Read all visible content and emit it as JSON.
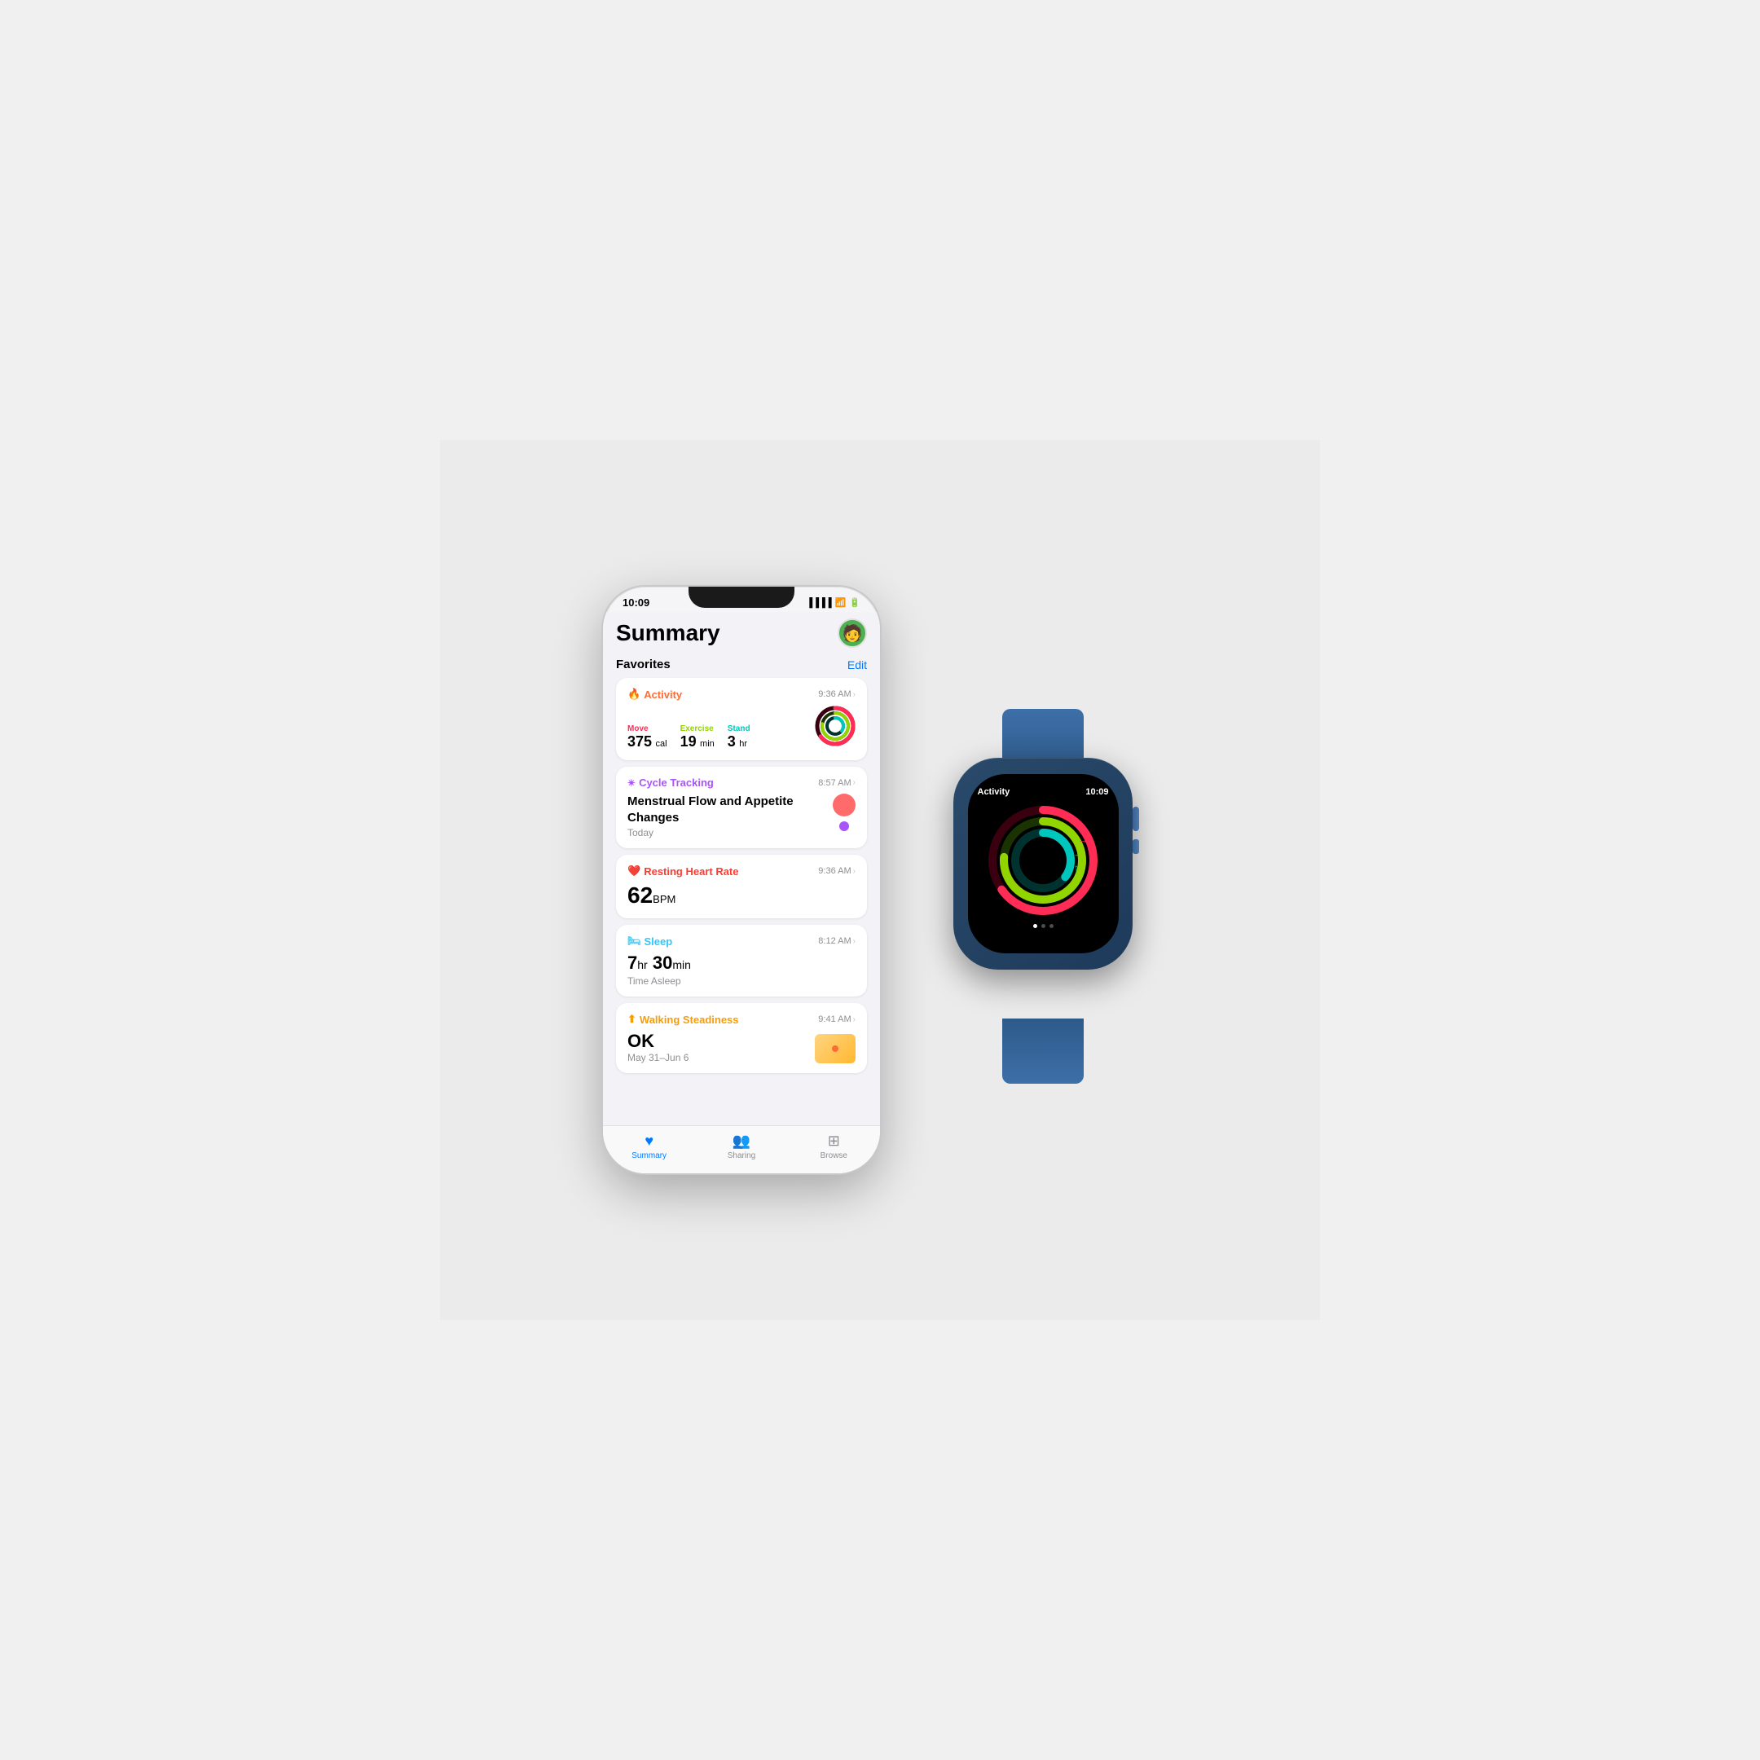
{
  "scene": {
    "background": "#ebebeb"
  },
  "iphone": {
    "status": {
      "time": "10:09",
      "signal": "●●●●",
      "wifi": "WiFi",
      "battery": "Battery"
    },
    "app": {
      "title": "Summary",
      "avatar_emoji": "🧑"
    },
    "favorites": {
      "label": "Favorites",
      "edit_label": "Edit"
    },
    "cards": {
      "activity": {
        "title": "Activity",
        "icon": "🔥",
        "time": "9:36 AM",
        "move_label": "Move",
        "move_value": "375",
        "move_unit": "cal",
        "exercise_label": "Exercise",
        "exercise_value": "19",
        "exercise_unit": "min",
        "stand_label": "Stand",
        "stand_value": "3",
        "stand_unit": "hr"
      },
      "cycle": {
        "title": "Cycle Tracking",
        "icon": "✴️",
        "time": "8:57 AM",
        "main_text": "Menstrual Flow and Appetite Changes",
        "sub_text": "Today"
      },
      "heart": {
        "title": "Resting Heart Rate",
        "icon": "❤️",
        "time": "9:36 AM",
        "value": "62",
        "unit": "BPM"
      },
      "sleep": {
        "title": "Sleep",
        "icon": "🛏",
        "time": "8:12 AM",
        "hours": "7",
        "hours_unit": "hr",
        "minutes": "30",
        "minutes_unit": "min",
        "sub_text": "Time Asleep"
      },
      "walking": {
        "title": "Walking Steadiness",
        "icon": "⬆",
        "time": "9:41 AM",
        "value": "OK",
        "date_range": "May 31–Jun 6"
      }
    },
    "tabs": {
      "summary": {
        "label": "Summary",
        "icon": "♥",
        "active": true
      },
      "sharing": {
        "label": "Sharing",
        "icon": "👥",
        "active": false
      },
      "browse": {
        "label": "Browse",
        "icon": "⊞",
        "active": false
      }
    }
  },
  "watch": {
    "app_name": "Activity",
    "time": "10:09",
    "dots": [
      true,
      false,
      false
    ],
    "rings": {
      "move": {
        "color": "#ff2d55",
        "progress": 0.65
      },
      "exercise": {
        "color": "#92d400",
        "progress": 0.75
      },
      "stand": {
        "color": "#00c7be",
        "progress": 0.35
      }
    }
  }
}
